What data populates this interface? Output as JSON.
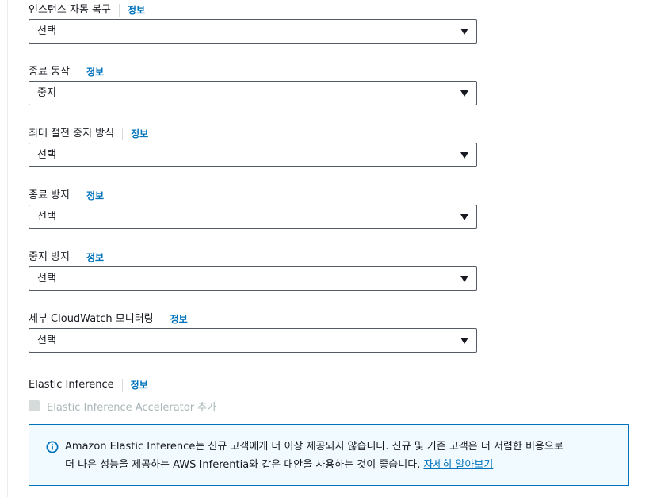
{
  "fields": [
    {
      "label": "인스턴스 자동 복구",
      "info": "정보",
      "value": "선택"
    },
    {
      "label": "종료 동작",
      "info": "정보",
      "value": "중지"
    },
    {
      "label": "최대 절전 중지 방식",
      "info": "정보",
      "value": "선택"
    },
    {
      "label": "종료 방지",
      "info": "정보",
      "value": "선택"
    },
    {
      "label": "중지 방지",
      "info": "정보",
      "value": "선택"
    },
    {
      "label": "세부 CloudWatch 모니터링",
      "info": "정보",
      "value": "선택"
    }
  ],
  "elastic_inference": {
    "label": "Elastic Inference",
    "info": "정보",
    "checkbox_label": "Elastic Inference Accelerator 추가",
    "checkbox_checked": false,
    "checkbox_disabled": true
  },
  "alert": {
    "icon": "info-circle-icon",
    "line1": "Amazon Elastic Inference는 신규 고객에게 더 이상 제공되지 않습니다. 신규 및 기존 고객은 더 저렴한 비용으로",
    "line2": "더 나은 성능을 제공하는 AWS Inferentia와 같은 대안을 사용하는 것이 좋습니다.",
    "link": "자세히 알아보기"
  },
  "colors": {
    "link": "#0073bb",
    "alert_border": "#0073bb",
    "alert_background": "#f1faff",
    "border": "#545b64",
    "disabled": "#aab7b8"
  }
}
